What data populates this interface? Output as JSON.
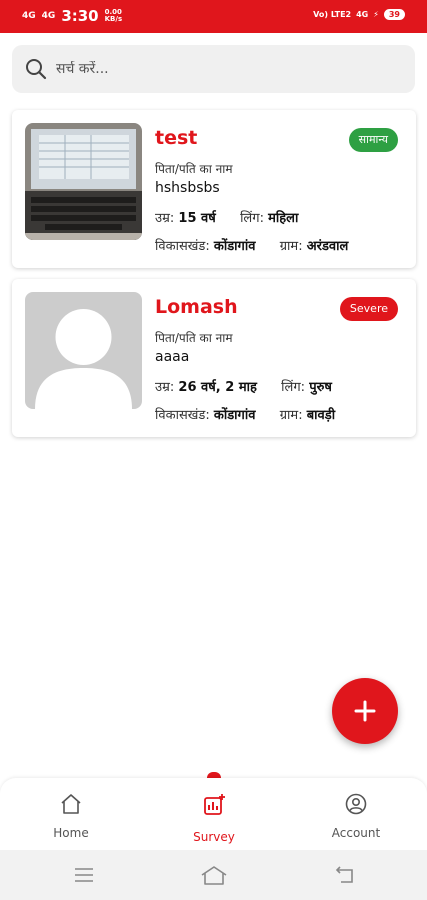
{
  "status_bar": {
    "net1": "4G",
    "net2": "4G",
    "time": "3:30",
    "speed_value": "0.00",
    "speed_unit": "KB/s",
    "volte": "Vo) LTE2",
    "net_right": "4G",
    "battery": "39"
  },
  "search": {
    "placeholder": "सर्च करें..."
  },
  "records": [
    {
      "name": "test",
      "badge": "सामान्य",
      "badge_color": "#2ea043",
      "parent_label": "पिता/पति का नाम",
      "parent_value": "hshsbsbs",
      "age_label": "उम्र:",
      "age_value": "15 वर्ष",
      "gender_label": "लिंग:",
      "gender_value": "महिला",
      "block_label": "विकासखंड:",
      "block_value": "कोंडागांव",
      "village_label": "ग्राम:",
      "village_value": "अरंडवाल"
    },
    {
      "name": "Lomash",
      "badge": "Severe",
      "badge_color": "#e0161c",
      "parent_label": "पिता/पति का नाम",
      "parent_value": "aaaa",
      "age_label": "उम्र:",
      "age_value": "26 वर्ष, 2 माह",
      "gender_label": "लिंग:",
      "gender_value": "पुरुष",
      "block_label": "विकासखंड:",
      "block_value": "कोंडागांव",
      "village_label": "ग्राम:",
      "village_value": "बावड़ी"
    }
  ],
  "fab": {
    "icon": "plus-icon"
  },
  "bottom_nav": {
    "home": "Home",
    "survey": "Survey",
    "account": "Account",
    "active": "survey",
    "accent": "#e0161c"
  }
}
